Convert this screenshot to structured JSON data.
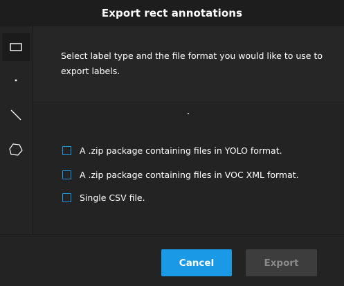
{
  "dialog": {
    "title": "Export rect annotations",
    "description": "Select label type and the file format you would like to use to export labels."
  },
  "sidebar": {
    "tools": [
      {
        "icon": "rect-icon",
        "active": true
      },
      {
        "icon": "point-icon",
        "active": false
      },
      {
        "icon": "line-icon",
        "active": false
      },
      {
        "icon": "polygon-icon",
        "active": false
      }
    ]
  },
  "options": [
    {
      "label": "A .zip package containing files in YOLO format.",
      "checked": false
    },
    {
      "label": "A .zip package containing files in VOC XML format.",
      "checked": false
    },
    {
      "label": "Single CSV file.",
      "checked": false
    }
  ],
  "buttons": {
    "cancel": "Cancel",
    "export": "Export"
  },
  "colors": {
    "accent": "#1a9ae6",
    "header_bg": "#1d1d1d",
    "disabled_button": "#3d3d3d"
  }
}
